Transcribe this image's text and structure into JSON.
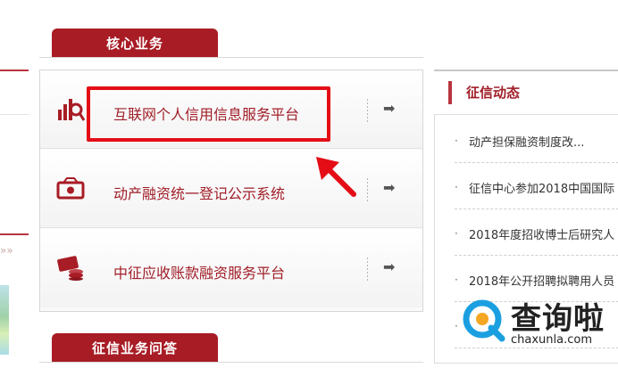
{
  "sections": {
    "core_business": "核心业务",
    "credit_qa": "征信业务问答"
  },
  "services": [
    {
      "label": "互联网个人信用信息服务平台",
      "icon": "chart-magnifier-icon",
      "arrow": "➡"
    },
    {
      "label": "动产融资统一登记公示系统",
      "icon": "money-icon",
      "arrow": "➡"
    },
    {
      "label": "中征应收账款融资服务平台",
      "icon": "card-coins-icon",
      "arrow": "➡"
    }
  ],
  "news": {
    "title": "征信动态",
    "items": [
      {
        "bullet": "·",
        "text": "动产担保融资制度改..."
      },
      {
        "bullet": "·",
        "text": "征信中心参加2018中国国际"
      },
      {
        "bullet": "·",
        "text": "2018年度招收博士后研究人"
      },
      {
        "bullet": "·",
        "text": "2018年公开招聘拟聘用人员"
      },
      {
        "bullet": "·",
        "text": "..."
      }
    ]
  },
  "left": {
    "more_chevrons": "»»"
  },
  "watermark": {
    "title": "查询啦",
    "url": "chaxunla.com"
  },
  "colors": {
    "brand_red": "#a81c25",
    "highlight_red": "#e40d16",
    "label_red": "#a01e28"
  }
}
